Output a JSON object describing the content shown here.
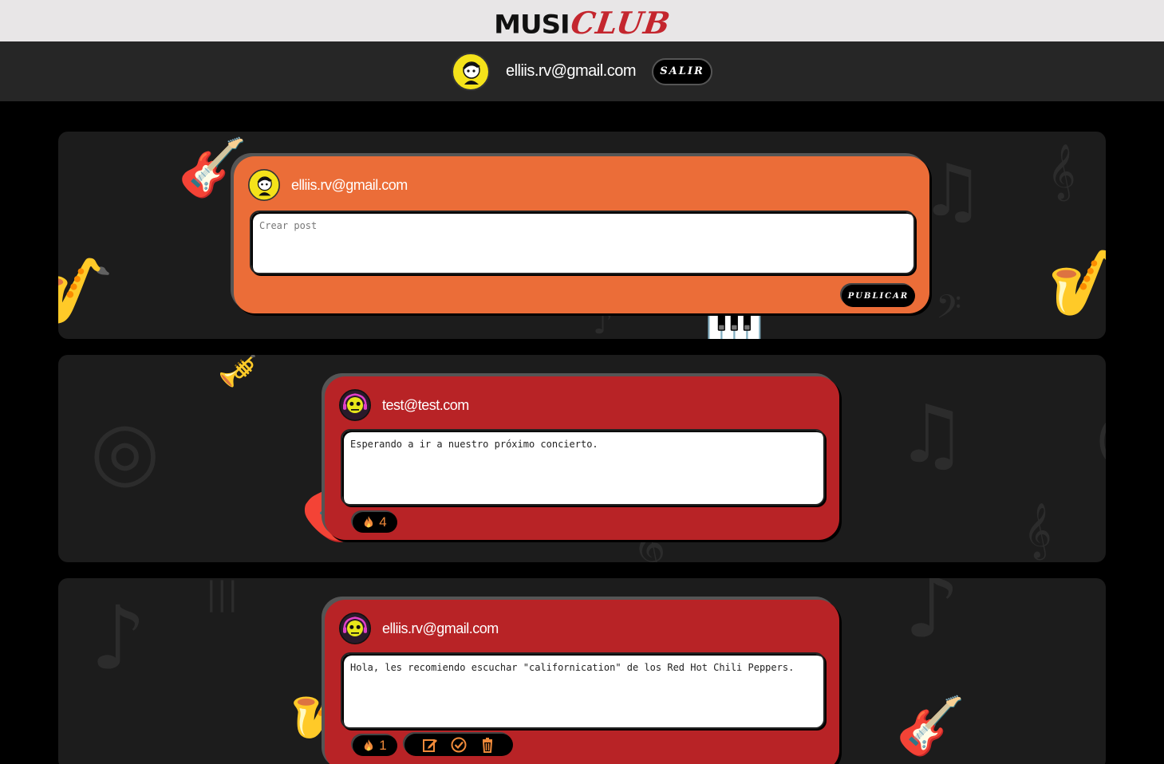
{
  "brand": {
    "part1": "MUSI",
    "part2": "CLUB"
  },
  "header": {
    "user_email": "elliis.rv@gmail.com",
    "logout_label": "SALIR"
  },
  "composer": {
    "author": "elliis.rv@gmail.com",
    "placeholder": "Crear post",
    "publish_label": "PUBLICAR"
  },
  "posts": [
    {
      "author": "test@test.com",
      "text": "Esperando a ir a nuestro próximo concierto.",
      "likes": "4",
      "own": false
    },
    {
      "author": "elliis.rv@gmail.com",
      "text": "Hola, les recomiendo escuchar \"californication\" de los Red Hot Chili Peppers.",
      "likes": "1",
      "own": true
    }
  ],
  "colors": {
    "composer_card": "#eb6d38",
    "post_card": "#b82326",
    "brand_red": "#c4262e",
    "flame": "#f08a3a"
  },
  "icons": {
    "flame": "fire-icon",
    "edit": "edit-icon",
    "confirm": "check-circle-icon",
    "delete": "trash-icon"
  }
}
